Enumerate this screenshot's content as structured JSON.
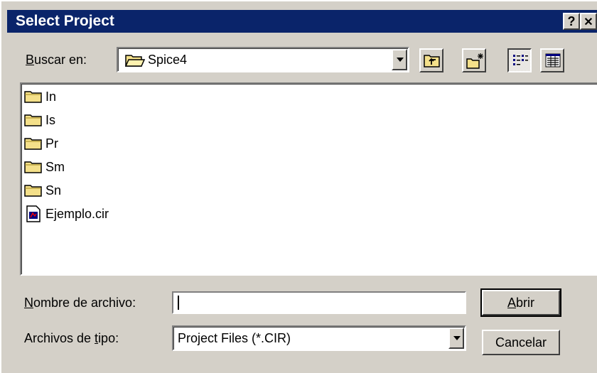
{
  "window": {
    "title": "Select Project",
    "help_glyph": "?",
    "close_glyph": "✕"
  },
  "lookin": {
    "label_pre": "",
    "label_accel": "B",
    "label_post": "uscar en:",
    "value": "Spice4"
  },
  "toolbar": {
    "icons": [
      "up-folder-icon",
      "new-folder-icon",
      "list-view-icon",
      "details-view-icon"
    ],
    "active_view": "list"
  },
  "files": {
    "items": [
      {
        "name": "In",
        "type": "folder"
      },
      {
        "name": "Is",
        "type": "folder"
      },
      {
        "name": "Pr",
        "type": "folder"
      },
      {
        "name": "Sm",
        "type": "folder"
      },
      {
        "name": "Sn",
        "type": "folder"
      },
      {
        "name": "Ejemplo.cir",
        "type": "file"
      }
    ]
  },
  "filename": {
    "label_accel": "N",
    "label_post": "ombre de archivo:",
    "value": ""
  },
  "filetype": {
    "label_pre": "Archivos de ",
    "label_accel": "t",
    "label_post": "ipo:",
    "value": "Project Files (*.CIR)"
  },
  "buttons": {
    "open_accel": "A",
    "open_post": "brir",
    "cancel": "Cancelar"
  },
  "colors": {
    "titlebar": "#0a246a",
    "face": "#d4d0c8",
    "folder": "#f4e08a"
  }
}
